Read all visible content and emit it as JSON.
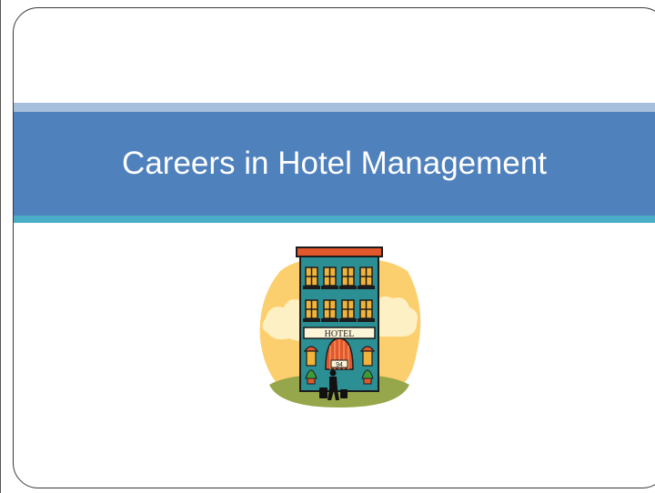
{
  "slide": {
    "title": "Careers in Hotel Management"
  },
  "illustration": {
    "sign_text": "HOTEL",
    "door_number": "94",
    "icon": "hotel-building-icon"
  },
  "colors": {
    "title_band": "#4f81bd",
    "title_band_top": "#a6bfdc",
    "accent_stripe": "#4bacc6",
    "title_text": "#ffffff"
  }
}
